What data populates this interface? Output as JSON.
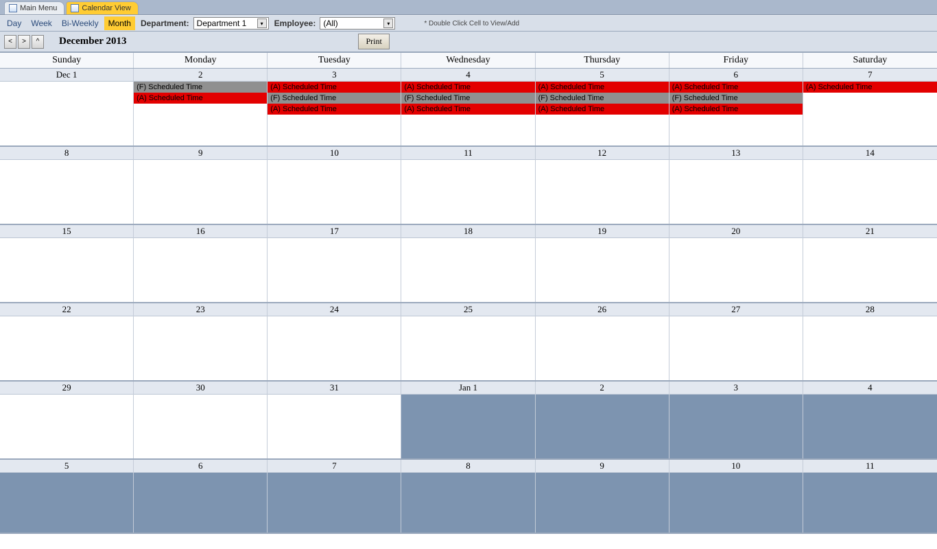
{
  "tabs": {
    "main_menu": "Main Menu",
    "calendar_view": "Calendar View"
  },
  "views": {
    "day": "Day",
    "week": "Week",
    "biweekly": "Bi-Weekly",
    "month": "Month"
  },
  "filters": {
    "department_label": "Department:",
    "department_value": "Department 1",
    "employee_label": "Employee:",
    "employee_value": "(All)"
  },
  "hint": "* Double Click Cell to View/Add",
  "nav": {
    "prev": "<",
    "next": ">",
    "up": "^"
  },
  "month_title": "December 2013",
  "print_label": "Print",
  "days_of_week": [
    "Sunday",
    "Monday",
    "Tuesday",
    "Wednesday",
    "Thursday",
    "Friday",
    "Saturday"
  ],
  "weeks": [
    {
      "cells": [
        {
          "label": "Dec 1",
          "events": []
        },
        {
          "label": "2",
          "events": [
            {
              "text": "(F) Scheduled Time",
              "color": "gray"
            },
            {
              "text": "(A) Scheduled Time",
              "color": "red"
            }
          ]
        },
        {
          "label": "3",
          "events": [
            {
              "text": "(A) Scheduled Time",
              "color": "red"
            },
            {
              "text": "(F) Scheduled Time",
              "color": "gray"
            },
            {
              "text": "(A) Scheduled Time",
              "color": "red"
            }
          ]
        },
        {
          "label": "4",
          "events": [
            {
              "text": "(A) Scheduled Time",
              "color": "red"
            },
            {
              "text": "(F) Scheduled Time",
              "color": "gray"
            },
            {
              "text": "(A) Scheduled Time",
              "color": "red"
            }
          ]
        },
        {
          "label": "5",
          "events": [
            {
              "text": "(A) Scheduled Time",
              "color": "red"
            },
            {
              "text": "(F) Scheduled Time",
              "color": "gray"
            },
            {
              "text": "(A) Scheduled Time",
              "color": "red"
            }
          ]
        },
        {
          "label": "6",
          "events": [
            {
              "text": "(A) Scheduled Time",
              "color": "red"
            },
            {
              "text": "(F) Scheduled Time",
              "color": "gray"
            },
            {
              "text": "(A) Scheduled Time",
              "color": "red"
            }
          ]
        },
        {
          "label": "7",
          "events": [
            {
              "text": "(A) Scheduled Time",
              "color": "red"
            }
          ]
        }
      ]
    },
    {
      "cells": [
        {
          "label": "8"
        },
        {
          "label": "9"
        },
        {
          "label": "10"
        },
        {
          "label": "11"
        },
        {
          "label": "12"
        },
        {
          "label": "13"
        },
        {
          "label": "14"
        }
      ]
    },
    {
      "cells": [
        {
          "label": "15"
        },
        {
          "label": "16"
        },
        {
          "label": "17"
        },
        {
          "label": "18"
        },
        {
          "label": "19"
        },
        {
          "label": "20"
        },
        {
          "label": "21"
        }
      ]
    },
    {
      "cells": [
        {
          "label": "22"
        },
        {
          "label": "23"
        },
        {
          "label": "24"
        },
        {
          "label": "25"
        },
        {
          "label": "26"
        },
        {
          "label": "27"
        },
        {
          "label": "28"
        }
      ]
    },
    {
      "cells": [
        {
          "label": "29"
        },
        {
          "label": "30"
        },
        {
          "label": "31"
        },
        {
          "label": "Jan 1",
          "outside": true
        },
        {
          "label": "2",
          "outside": true
        },
        {
          "label": "3",
          "outside": true
        },
        {
          "label": "4",
          "outside": true
        }
      ]
    },
    {
      "cells": [
        {
          "label": "5",
          "outside": true
        },
        {
          "label": "6",
          "outside": true
        },
        {
          "label": "7",
          "outside": true
        },
        {
          "label": "8",
          "outside": true
        },
        {
          "label": "9",
          "outside": true
        },
        {
          "label": "10",
          "outside": true
        },
        {
          "label": "11",
          "outside": true
        }
      ]
    }
  ]
}
